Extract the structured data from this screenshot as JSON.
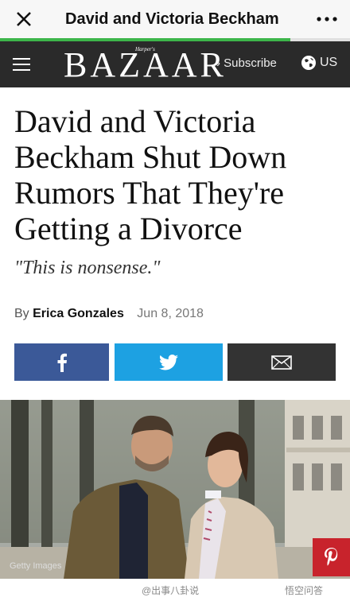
{
  "browser": {
    "title": "David and Victoria Beckham",
    "progress": 0.83
  },
  "site": {
    "logo": "BAZAAR",
    "logo_super": "Harper's",
    "subscribe_label": "Subscribe",
    "region_label": "US"
  },
  "article": {
    "headline": "David and Victoria Beckham Shut Down Rumors That They're Getting a Divorce",
    "dek": "\"This is nonsense.\"",
    "by_prefix": "By",
    "author": "Erica Gonzales",
    "date": "Jun 8, 2018"
  },
  "share": {
    "facebook_icon": "facebook-icon",
    "twitter_icon": "twitter-icon",
    "email_icon": "envelope-icon"
  },
  "photo": {
    "credit": "Getty Images",
    "pinterest_icon": "pinterest-icon"
  },
  "watermark": {
    "left": "@出事八卦说",
    "right": "悟空问答"
  },
  "colors": {
    "facebook": "#3b5998",
    "twitter": "#1da1e2",
    "email": "#333333",
    "pinterest": "#c8232c",
    "progress": "#3db54a",
    "site_header": "#2a2a2a"
  }
}
